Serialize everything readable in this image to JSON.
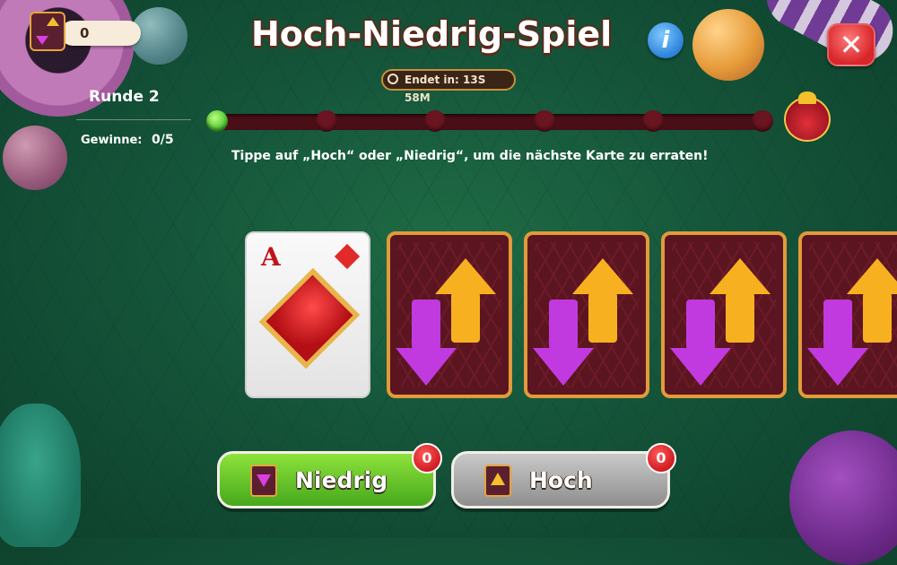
{
  "header": {
    "title": "Hoch-Niedrig-Spiel",
    "timer_text": "Endet in: 13S 58M",
    "info_label": "i",
    "close_label": "✕"
  },
  "currency": {
    "value": "0",
    "icon": "high-low-ticket-icon"
  },
  "stats": {
    "round_label": "Runde 2",
    "wins_label": "Gewinne:",
    "wins_value": "0/5"
  },
  "progress": {
    "completed": 1,
    "total_steps": 6,
    "reward_icon": "gift-icon"
  },
  "instruction": "Tippe auf „Hoch“ oder „Niedrig“, um die nächste Karte zu erraten!",
  "cards": {
    "revealed": {
      "rank": "A",
      "suit": "diamonds"
    },
    "hidden_count": 4
  },
  "buttons": {
    "low": {
      "label": "Niedrig",
      "badge": "0",
      "color": "#46a81c"
    },
    "high": {
      "label": "Hoch",
      "badge": "0",
      "color": "#8e8e8e"
    }
  }
}
